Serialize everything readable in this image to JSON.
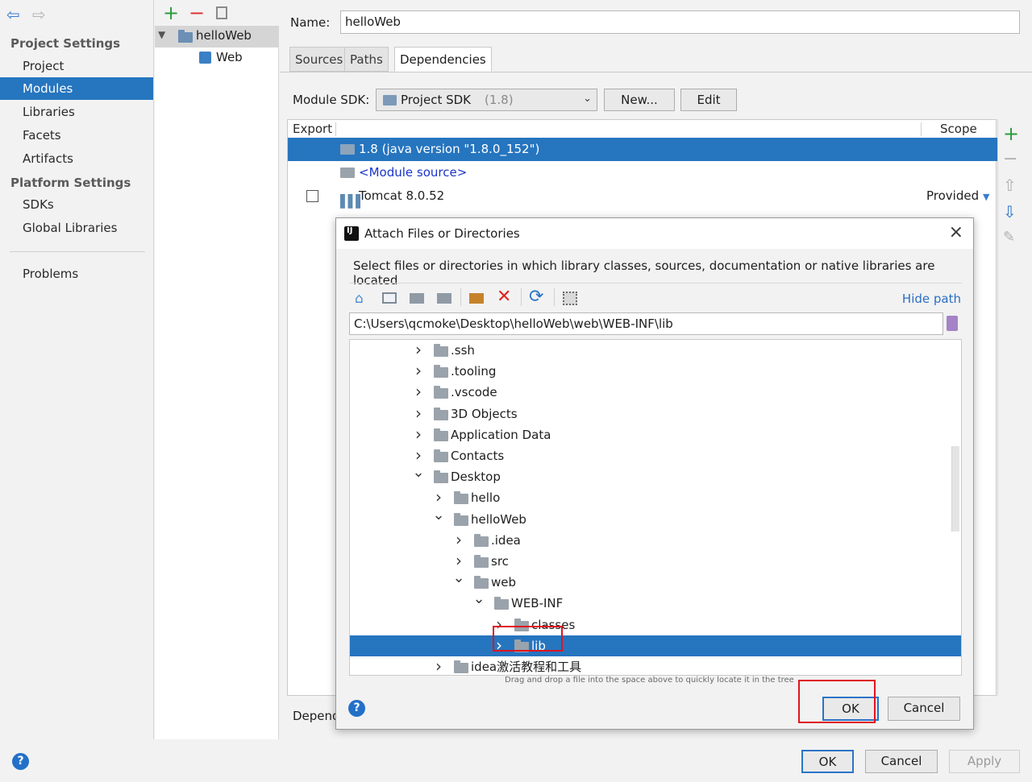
{
  "sidebar": {
    "project_settings_header": "Project Settings",
    "project_settings_items": [
      "Project",
      "Modules",
      "Libraries",
      "Facets",
      "Artifacts"
    ],
    "selected": "Modules",
    "platform_settings_header": "Platform Settings",
    "platform_settings_items": [
      "SDKs",
      "Global Libraries"
    ],
    "problems": "Problems"
  },
  "module_tree": {
    "root": "helloWeb",
    "child": "Web"
  },
  "module": {
    "name_label": "Name:",
    "name_value": "helloWeb",
    "tabs": [
      "Sources",
      "Paths",
      "Dependencies"
    ],
    "active_tab": "Dependencies",
    "sdk_label": "Module SDK:",
    "sdk_value": "Project SDK",
    "sdk_version": "(1.8)",
    "new_button": "New...",
    "edit_button": "Edit",
    "table_headers": {
      "export": "Export",
      "scope": "Scope"
    },
    "dependencies": [
      {
        "name": "1.8 (java version \"1.8.0_152\")",
        "scope": ""
      },
      {
        "name": "<Module source>",
        "scope": ""
      },
      {
        "name": "Tomcat 8.0.52",
        "scope": "Provided"
      }
    ],
    "dependencies_storage_label": "Depend"
  },
  "dialog": {
    "title": "Attach Files or Directories",
    "description": "Select files or directories in which library classes, sources, documentation or native libraries are located",
    "hide_path": "Hide path",
    "path": "C:\\Users\\qcmoke\\Desktop\\helloWeb\\web\\WEB-INF\\lib",
    "tree": [
      {
        "name": ".ssh",
        "depth": 0,
        "expanded": false
      },
      {
        "name": ".tooling",
        "depth": 0,
        "expanded": false
      },
      {
        "name": ".vscode",
        "depth": 0,
        "expanded": false
      },
      {
        "name": "3D Objects",
        "depth": 0,
        "expanded": false
      },
      {
        "name": "Application Data",
        "depth": 0,
        "expanded": false
      },
      {
        "name": "Contacts",
        "depth": 0,
        "expanded": false
      },
      {
        "name": "Desktop",
        "depth": 0,
        "expanded": true
      },
      {
        "name": "hello",
        "depth": 1,
        "expanded": false
      },
      {
        "name": "helloWeb",
        "depth": 1,
        "expanded": true
      },
      {
        "name": ".idea",
        "depth": 2,
        "expanded": false
      },
      {
        "name": "src",
        "depth": 2,
        "expanded": false
      },
      {
        "name": "web",
        "depth": 2,
        "expanded": true
      },
      {
        "name": "WEB-INF",
        "depth": 3,
        "expanded": true
      },
      {
        "name": "classes",
        "depth": 4,
        "expanded": false
      },
      {
        "name": "lib",
        "depth": 4,
        "expanded": false,
        "selected": true
      },
      {
        "name": "idea激活教程和工具",
        "depth": 1,
        "expanded": false
      }
    ],
    "drag_hint": "Drag and drop a file into the space above to quickly locate it in the tree",
    "ok": "OK",
    "cancel": "Cancel"
  },
  "footer": {
    "ok": "OK",
    "cancel": "Cancel",
    "apply": "Apply"
  },
  "colors": {
    "selection": "#2675bf",
    "highlight_box": "#e0141e",
    "add_green": "#2a9d3c",
    "remove_red": "#dd3333"
  }
}
